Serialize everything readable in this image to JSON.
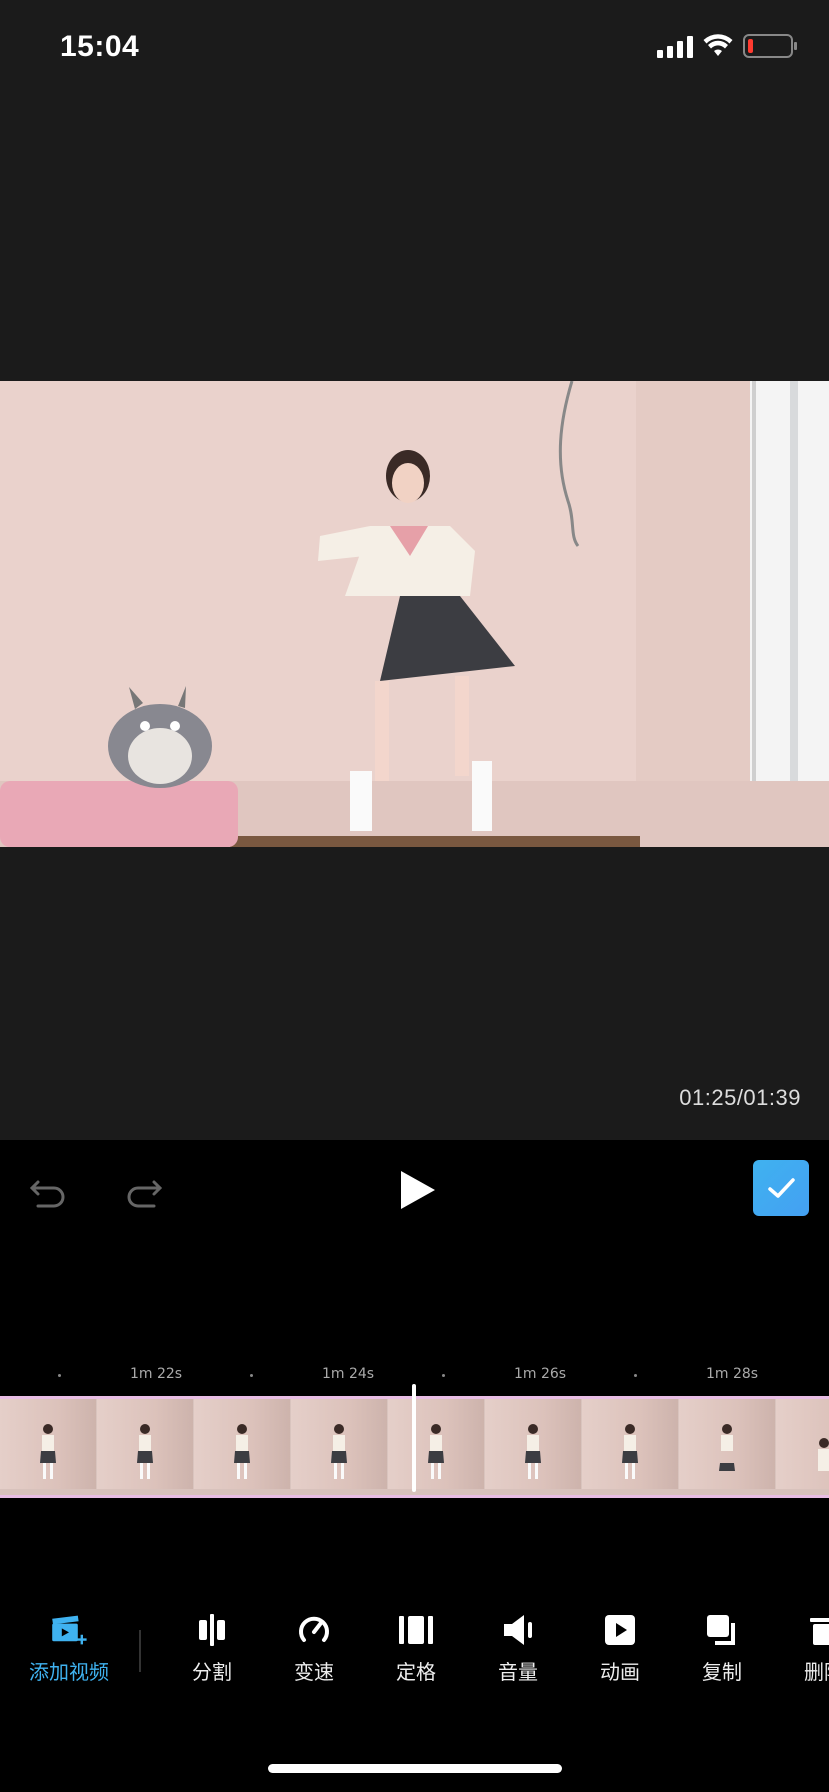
{
  "status": {
    "time": "15:04"
  },
  "preview": {
    "time_readout": "01:25/01:39"
  },
  "timeline": {
    "ruler": [
      "1m 22s",
      "1m 24s",
      "1m 26s",
      "1m 28s"
    ]
  },
  "toolbar": {
    "items": [
      {
        "label": "添加视频",
        "icon": "add-video-icon",
        "active": true
      },
      {
        "label": "分割",
        "icon": "split-icon"
      },
      {
        "label": "变速",
        "icon": "speed-icon"
      },
      {
        "label": "定格",
        "icon": "freeze-icon"
      },
      {
        "label": "音量",
        "icon": "volume-icon"
      },
      {
        "label": "动画",
        "icon": "animation-icon"
      },
      {
        "label": "复制",
        "icon": "copy-icon"
      },
      {
        "label": "删除",
        "icon": "delete-icon"
      }
    ]
  },
  "colors": {
    "accent": "#3fb2f0",
    "track_border": "#e8bde4",
    "background": "#000000",
    "preview_bg": "#1b1b1b"
  }
}
